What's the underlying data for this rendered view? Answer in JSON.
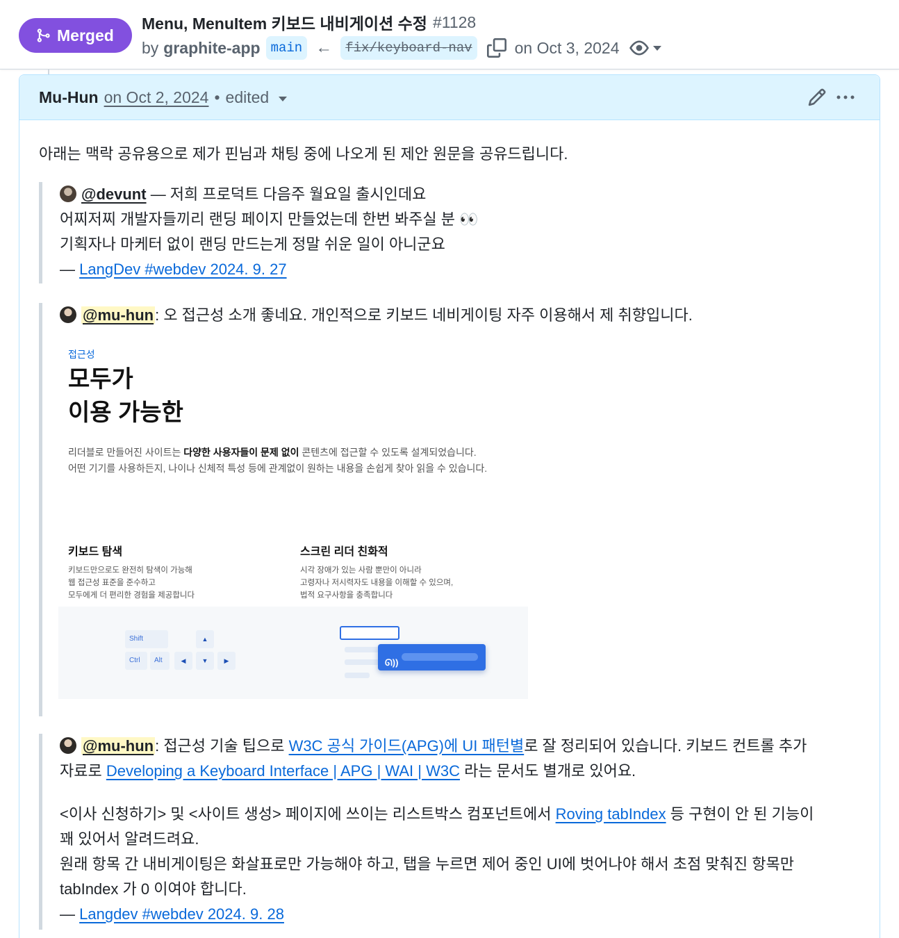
{
  "pr": {
    "state": "Merged",
    "title": "Menu, MenuItem 키보드 내비게이션 수정",
    "number": "#1128",
    "by": "by",
    "author": "graphite-app",
    "base_branch": "main",
    "head_branch": "fix/keyboard-nav",
    "merged_date": "on Oct 3, 2024",
    "state_color": "#8250df"
  },
  "comment": {
    "author": "Mu-Hun",
    "date": "on Oct 2, 2024",
    "separator": "•",
    "edited": "edited",
    "intro": "아래는 맥락 공유용으로 제가 핀님과 채팅 중에 나오게 된 제안 원문을 공유드립니다.",
    "quote1": {
      "mention": "@devunt",
      "line1_rest": " — 저희 프로덕트 다음주 월요일 출시인데요",
      "line2": "어찌저찌 개발자들끼리 랜딩 페이지 만들었는데 한번 봐주실 분 👀",
      "line3": "기획자나 마케터 없이 랜딩 만드는게 정말 쉬운 일이 아니군요",
      "dash": "— ",
      "source": "LangDev #webdev 2024. 9. 27"
    },
    "quote2": {
      "mention": "@mu-hun",
      "rest": ": 오 접근성 소개 좋네요. 개인적으로 키보드 네비게이팅 자주 이용해서 제 취향입니다."
    },
    "embed": {
      "tag": "접근성",
      "heading_line1": "모두가",
      "heading_line2": "이용 가능한",
      "desc_line1_a": "리더블로 만들어진 사이트는 ",
      "desc_line1_b": "다양한 사용자들이 문제 없이",
      "desc_line1_c": " 콘텐츠에 접근할 수 있도록 설계되었습니다.",
      "desc_line2": "어떤 기기를 사용하든지, 나이나 신체적 특성 등에 관계없이 원하는 내용을 손쉽게 찾아 읽을 수 있습니다.",
      "feature1_title": "키보드 탐색",
      "feature1_l1": "키보드만으로도 완전히 탐색이 가능해",
      "feature1_l2": "웹 접근성 표준을 준수하고",
      "feature1_l3": "모두에게 더 편리한 경험을 제공합니다",
      "feature2_title": "스크린 리더 친화적",
      "feature2_l1": "시각 장애가 있는 사람 뿐만이 아니라",
      "feature2_l2": "고령자나 저시력자도 내용을 이해할 수 있으며,",
      "feature2_l3": "법적 요구사항을 충족합니다",
      "keys": {
        "shift": "Shift",
        "ctrl": "Ctrl",
        "alt": "Alt",
        "up": "▲",
        "left": "◀",
        "down": "▼",
        "right": "▶"
      },
      "sr_icon": "ear-sound-icon",
      "accent": "#2f6fe4"
    },
    "quote3": {
      "mention": "@mu-hun",
      "p1_a": ": 접근성 기술 팁으로 ",
      "p1_link": "W3C 공식 가이드(APG)에 UI 패턴별",
      "p1_b": "로 잘 정리되어 있습니다. 키보드 컨트롤 추가",
      "p1_c": "자료로 ",
      "p1_link2": "Developing a Keyboard Interface | APG | WAI | W3C",
      "p1_d": " 라는 문서도 별개로 있어요.",
      "p2_a": "<이사 신청하기> 및 <사이트 생성> 페이지에 쓰이는 리스트박스 컴포넌트에서 ",
      "p2_link": "Roving tabIndex",
      "p2_b": " 등 구현이 안 된 기능이",
      "p2_c": "꽤 있어서 알려드려요.",
      "p2_d": "원래 항목 간 내비게이팅은 화살표로만 가능해야 하고, 탭을 누르면 제어 중인 UI에 벗어나야 해서 초점 맞춰진 항목만",
      "p2_e": "tabIndex 가 0 이여야 합니다.",
      "dash": "— ",
      "source": "Langdev #webdev 2024. 9. 28"
    }
  },
  "colors": {
    "link": "#0969da",
    "header_bg": "#ddf4ff",
    "mention_highlight": "#fff8c5"
  }
}
